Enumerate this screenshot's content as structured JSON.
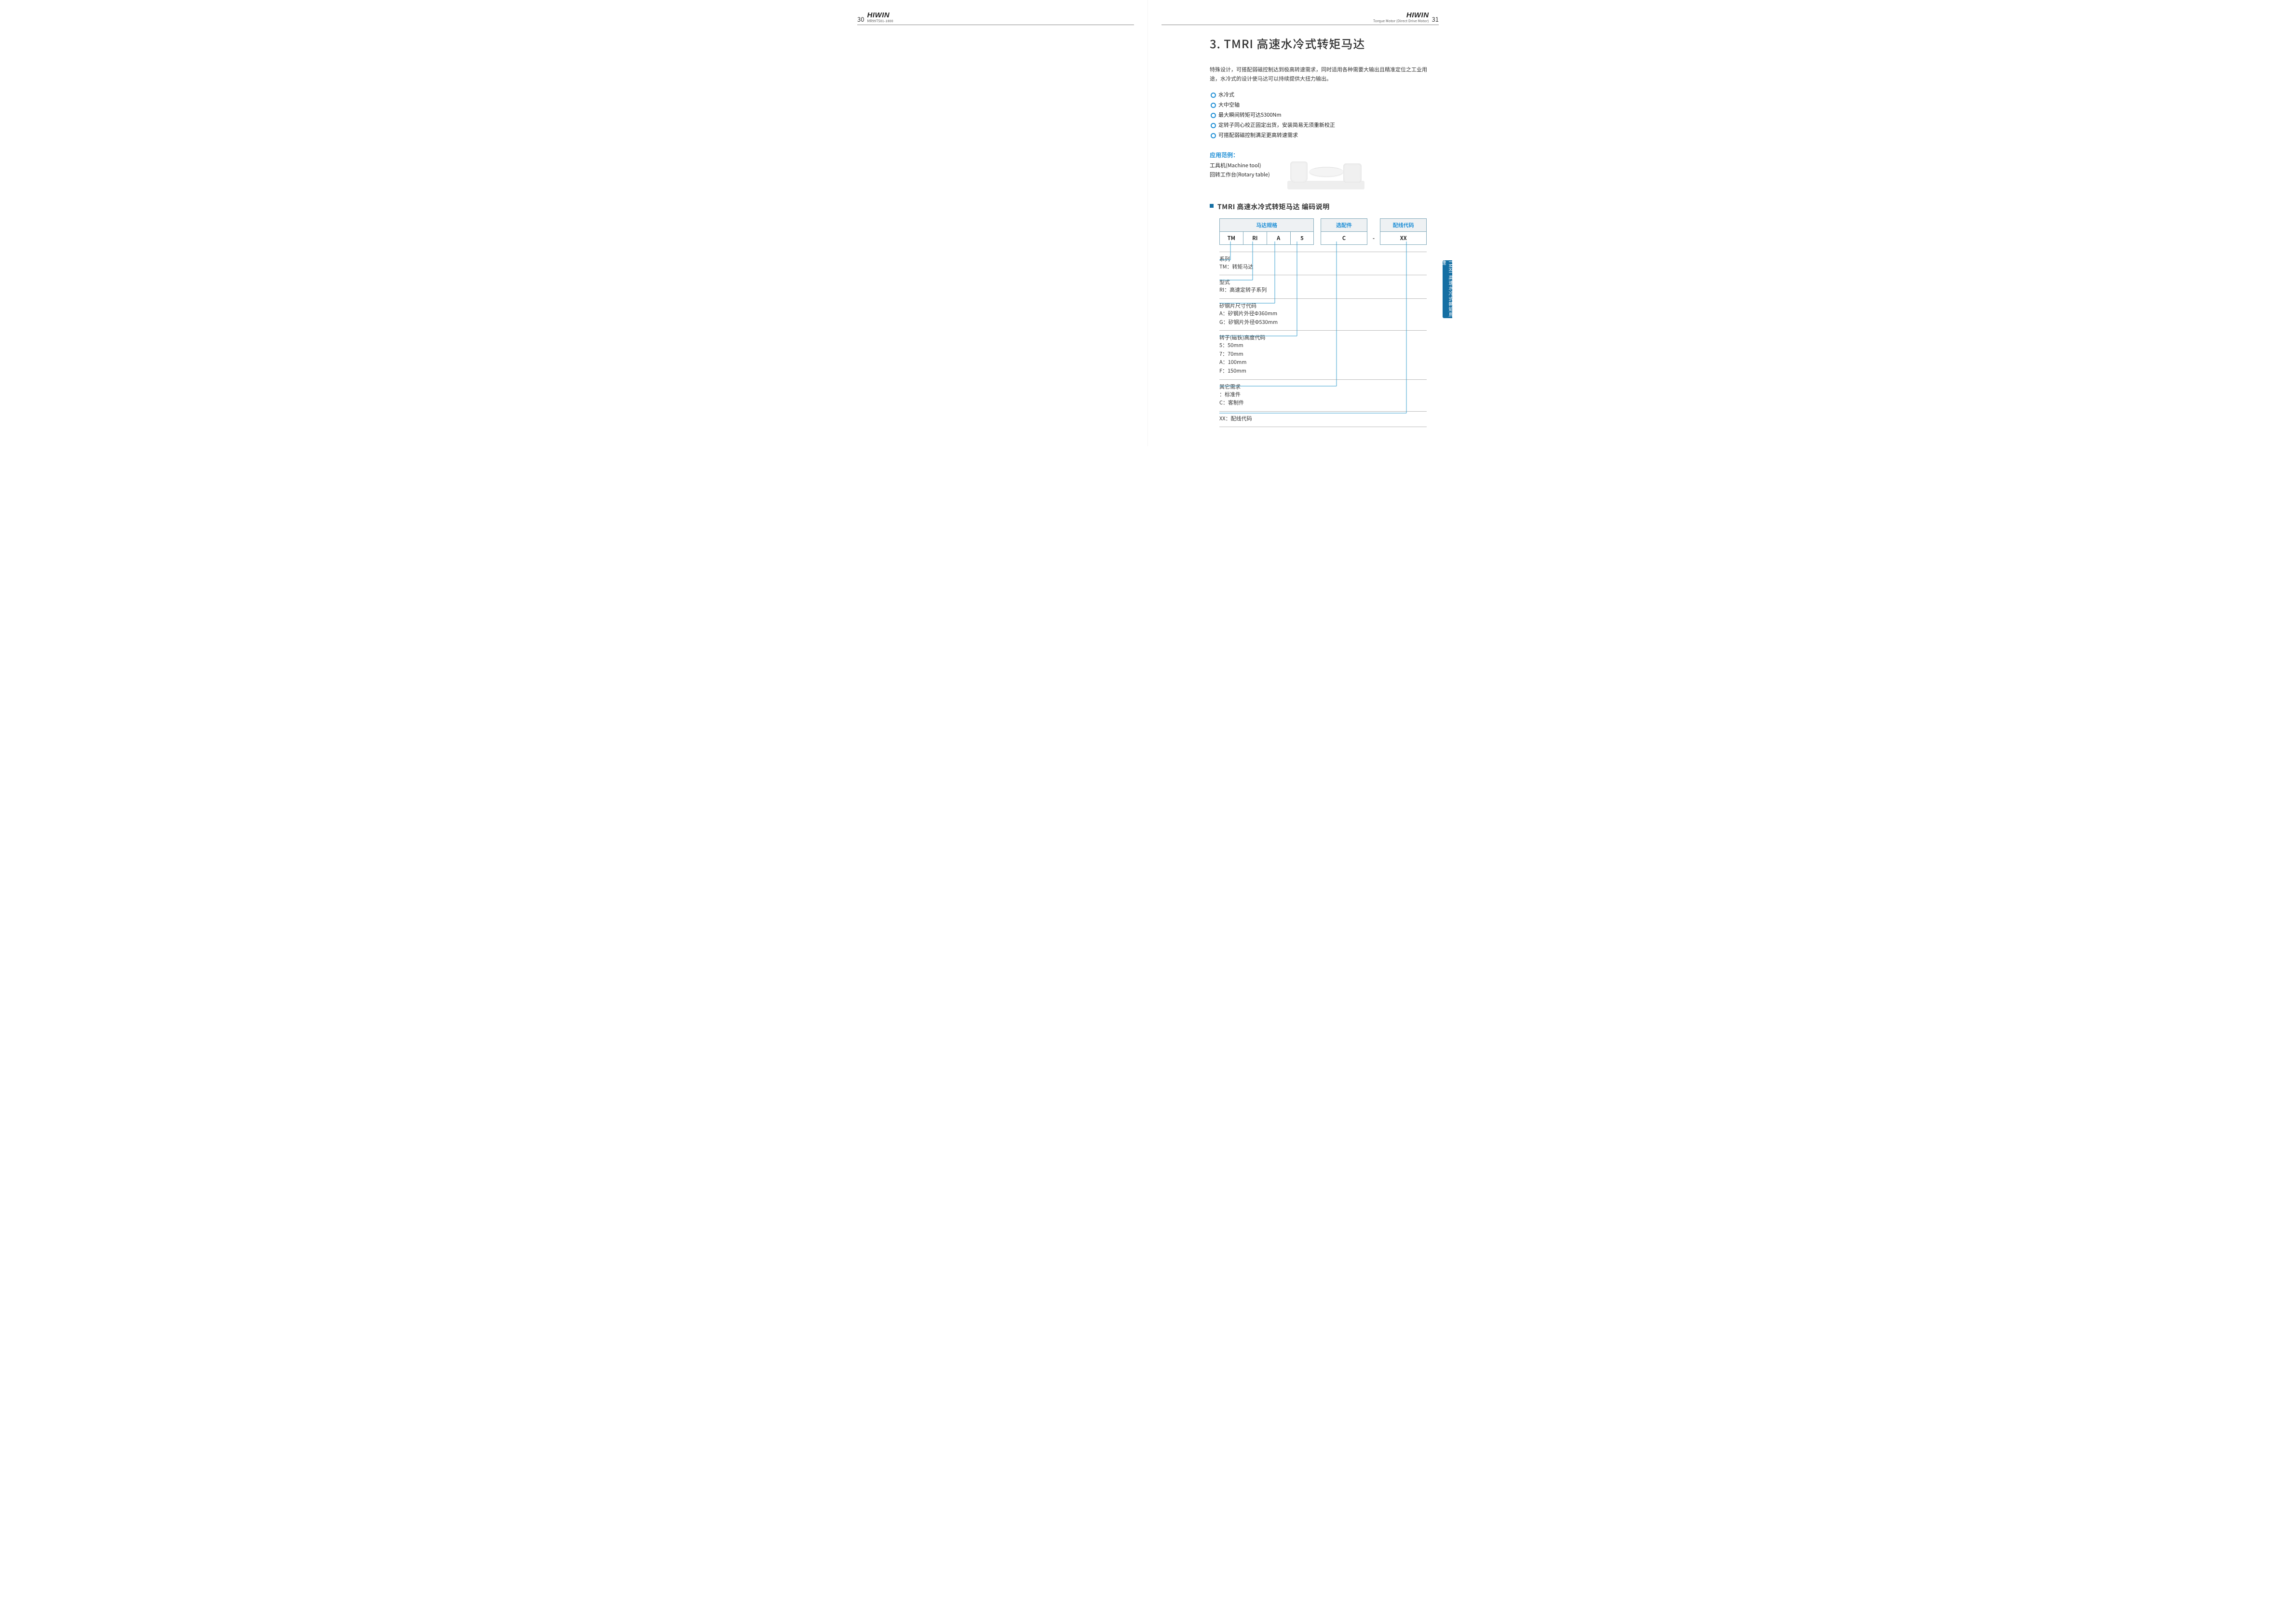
{
  "header_left": {
    "page_no": "30",
    "brand": "HIWIN",
    "doc_code": "MR99TS01-1800"
  },
  "header_right": {
    "brand": "HIWIN",
    "subtitle": "Torque Motor (Direct Drive Motor)",
    "page_no": "31"
  },
  "title": "3. TMRI 高速水冷式转矩马达",
  "intro": "特殊设计，可搭配弱磁控制达到极高转速需求，同时适用各种需要大输出且精准定位之工业用途，水冷式的设计使马达可以持续提供大扭力输出。",
  "features": [
    "水冷式",
    "大中空轴",
    "最大瞬间转矩可达5300Nm",
    "定转子同心校正固定出货，安装简易无须重新校正",
    "可搭配弱磁控制满足更高转速需求"
  ],
  "apps": {
    "heading": "应用范例：",
    "lines": [
      "工具机(Machine tool)",
      "回转工作台(Rotary table)"
    ]
  },
  "subheading": "TMRI 高速水冷式转矩马达 编码说明",
  "code_table": {
    "group_headers": [
      "马达规格",
      "选配件",
      "配线代码"
    ],
    "cells": [
      "TM",
      "RI",
      "A",
      "5",
      "C",
      "-",
      "XX"
    ]
  },
  "explain": [
    {
      "title": "系列",
      "lines": [
        "TM：转矩马达"
      ]
    },
    {
      "title": "型式",
      "lines": [
        "RI：高速定转子系列"
      ]
    },
    {
      "title": "矽钢片尺寸代码",
      "lines": [
        "A：矽钢片外径Φ360mm",
        "G：矽钢片外径Φ530mm"
      ]
    },
    {
      "title": "转子(磁铁)高度代码",
      "lines": [
        "5：50mm",
        "7：70mm",
        "A：100mm",
        "F：150mm"
      ]
    },
    {
      "title": "其它需求",
      "lines": [
        "  ：标准件",
        "C：客制件"
      ]
    },
    {
      "title": "",
      "lines": [
        "XX：配线代码"
      ]
    }
  ],
  "sidetab": "TMRI 高速水冷式轉矩馬達"
}
